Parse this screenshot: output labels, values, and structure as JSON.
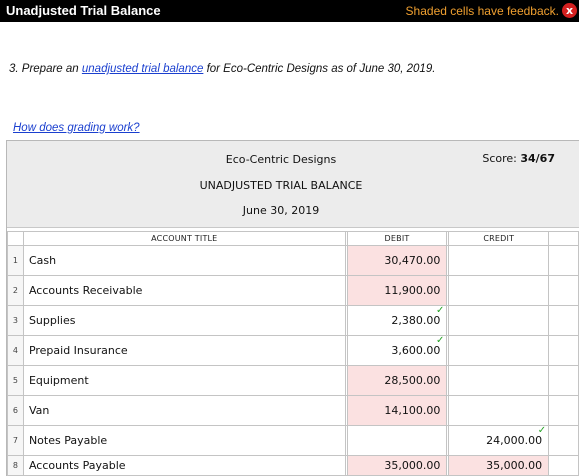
{
  "window": {
    "title": "Unadjusted Trial Balance",
    "feedback_note": "Shaded cells have feedback.",
    "close_glyph": "x"
  },
  "question": {
    "prefix": "3. Prepare an ",
    "link_text": "unadjusted trial balance",
    "suffix": " for Eco-Centric Designs as of June 30, 2019."
  },
  "grading_link": "How does grading work?",
  "worksheet": {
    "company": "Eco-Centric Designs",
    "report_title": "UNADJUSTED TRIAL BALANCE",
    "date": "June 30, 2019",
    "score_label": "Score:",
    "score_value": "34/67",
    "columns": {
      "account": "ACCOUNT TITLE",
      "debit": "DEBIT",
      "credit": "CREDIT"
    },
    "rows": [
      {
        "num": "1",
        "account": "Cash",
        "debit": "30,470.00",
        "credit": ""
      },
      {
        "num": "2",
        "account": "Accounts Receivable",
        "debit": "11,900.00",
        "credit": ""
      },
      {
        "num": "3",
        "account": "Supplies",
        "debit": "2,380.00",
        "credit": ""
      },
      {
        "num": "4",
        "account": "Prepaid Insurance",
        "debit": "3,600.00",
        "credit": ""
      },
      {
        "num": "5",
        "account": "Equipment",
        "debit": "28,500.00",
        "credit": ""
      },
      {
        "num": "6",
        "account": "Van",
        "debit": "14,100.00",
        "credit": ""
      },
      {
        "num": "7",
        "account": "Notes Payable",
        "debit": "",
        "credit": "24,000.00"
      },
      {
        "num": "8",
        "account": "Accounts Payable",
        "debit": "35,000.00",
        "credit": "35,000.00"
      }
    ]
  },
  "colors": {
    "shaded_cell": "#fbe1e1",
    "check": "#28a428",
    "link": "#1a3fcf",
    "feedback": "#f0a030"
  },
  "icons": {
    "correct": "check-mark-icon",
    "close": "close-icon"
  }
}
